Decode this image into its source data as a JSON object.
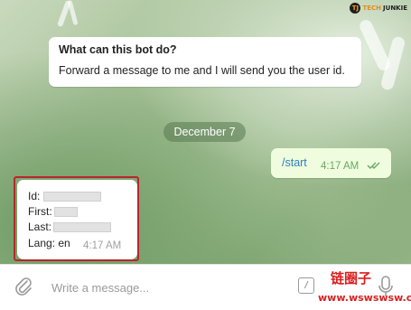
{
  "brand": {
    "logo": "TJ",
    "name_part1": "TECH",
    "name_part2": "JUNKIE"
  },
  "bot_info": {
    "title": "What can this bot do?",
    "text": "Forward a message to me and I will send you the user id."
  },
  "date_separator": "December 7",
  "outgoing_message": {
    "text": "/start",
    "time": "4:17 AM",
    "status_icon": "double-check-icon"
  },
  "incoming_message": {
    "fields": [
      {
        "label": "Id:"
      },
      {
        "label": "First:"
      },
      {
        "label": "Last:"
      },
      {
        "label": "Lang: en"
      }
    ],
    "time": "4:17 AM"
  },
  "composer": {
    "placeholder": "Write a message...",
    "command_symbol": "/",
    "attach_icon": "paperclip-icon",
    "mic_icon": "microphone-icon"
  },
  "watermark": {
    "top": "链圈子",
    "bottom": "www.wswswsw.cn"
  },
  "colors": {
    "highlight_border": "#b8262c",
    "outgoing_bubble": "#effdde",
    "outgoing_text": "#2e7fbe",
    "check_color": "#6aa768"
  }
}
